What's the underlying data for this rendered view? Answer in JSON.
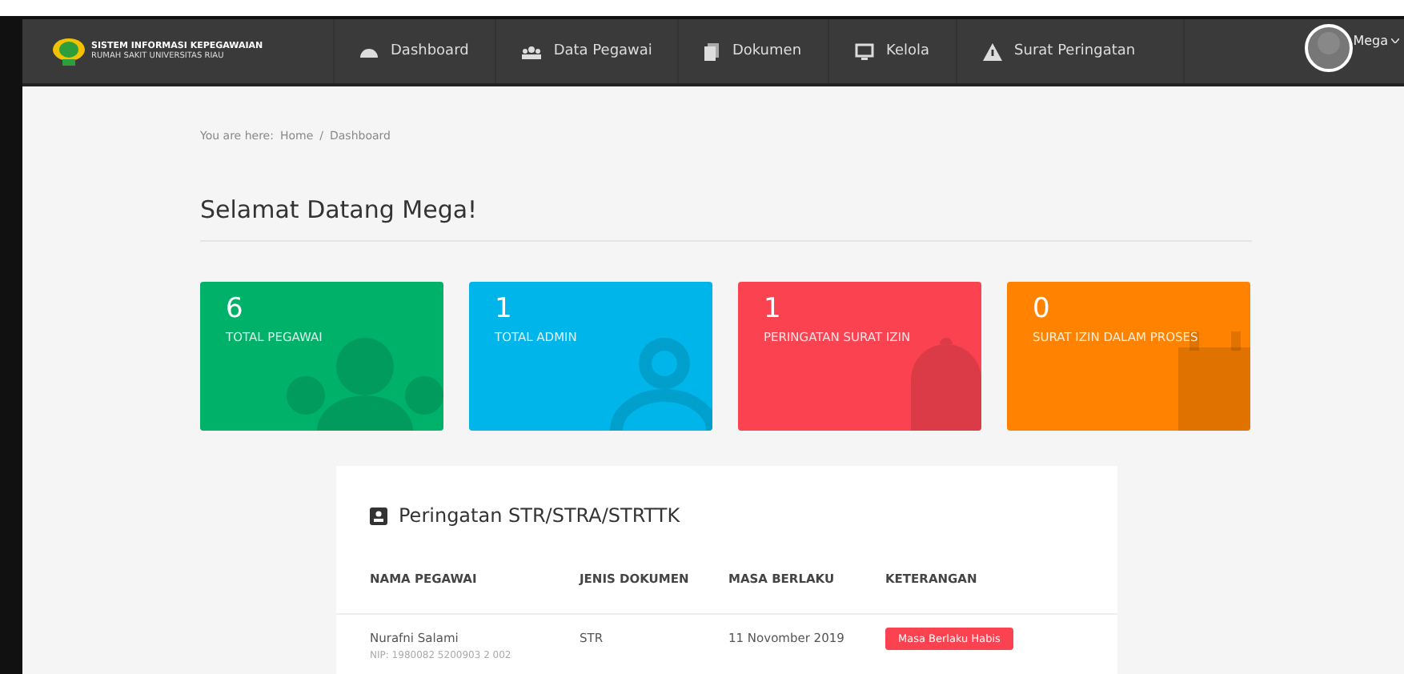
{
  "brand": {
    "title": "SISTEM INFORMASI KEPEGAWAIAN",
    "subtitle": "RUMAH SAKIT UNIVERSITAS RIAU"
  },
  "nav": [
    {
      "label": "Dashboard"
    },
    {
      "label": "Data Pegawai"
    },
    {
      "label": "Dokumen"
    },
    {
      "label": "Kelola"
    },
    {
      "label": "Surat Peringatan"
    }
  ],
  "user": {
    "name": "Mega"
  },
  "breadcrumb": {
    "prefix": "You are here:",
    "items": [
      "Home",
      "Dashboard"
    ],
    "separator": "/"
  },
  "heading": "Selamat Datang Mega!",
  "stats": [
    {
      "value": "6",
      "label": "TOTAL PEGAWAI",
      "color": "#00b16a",
      "kind": "group"
    },
    {
      "value": "1",
      "label": "TOTAL ADMIN",
      "color": "#00b5e9",
      "kind": "person"
    },
    {
      "value": "1",
      "label": "PERINGATAN SURAT IZIN",
      "color": "#fa4251",
      "kind": "bell"
    },
    {
      "value": "0",
      "label": "SURAT IZIN DALAM PROSES",
      "color": "#ff8300",
      "kind": "calendar"
    }
  ],
  "panel": {
    "title": "Peringatan STR/STRA/STRTTK",
    "columns": [
      "NAMA PEGAWAI",
      "JENIS DOKUMEN",
      "MASA BERLAKU",
      "KETERANGAN"
    ],
    "rows": [
      {
        "name": "Nurafni Salami",
        "nip": "NIP: 1980082 5200903 2 002",
        "document": "STR",
        "valid_until": "11 Novomber 2019",
        "status": "Masa Berlaku Habis"
      }
    ]
  }
}
